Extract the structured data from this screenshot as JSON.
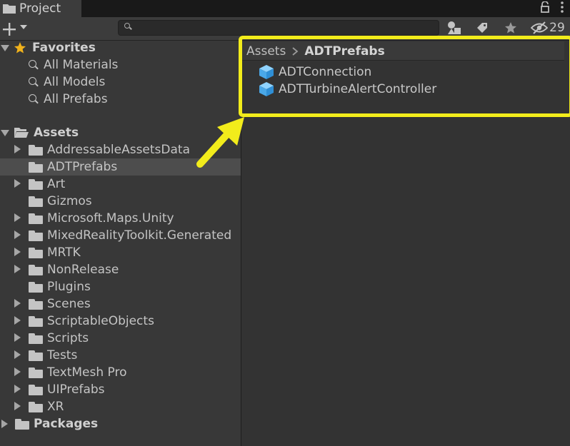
{
  "window": {
    "tab_title": "Project",
    "tab_icon": "folder-icon",
    "lock_icon": "lock-icon",
    "menu_icon": "kebab-menu-icon"
  },
  "toolbar": {
    "add_icon": "plus-icon",
    "search": {
      "value": "",
      "placeholder": ""
    },
    "filter_type_icon": "shapes-icon",
    "filter_label_icon": "tag-icon",
    "favorites_icon": "star-icon",
    "hidden_packages_icon": "eye-slash-icon",
    "hidden_count": "29"
  },
  "tree": {
    "favorites": {
      "label": "Favorites",
      "items": [
        "All Materials",
        "All Models",
        "All Prefabs"
      ]
    },
    "assets": {
      "label": "Assets",
      "folders": [
        {
          "label": "AddressableAssetsData",
          "expandable": true,
          "selected": false
        },
        {
          "label": "ADTPrefabs",
          "expandable": false,
          "selected": true
        },
        {
          "label": "Art",
          "expandable": true,
          "selected": false
        },
        {
          "label": "Gizmos",
          "expandable": false,
          "selected": false
        },
        {
          "label": "Microsoft.Maps.Unity",
          "expandable": true,
          "selected": false
        },
        {
          "label": "MixedRealityToolkit.Generated",
          "expandable": true,
          "selected": false
        },
        {
          "label": "MRTK",
          "expandable": true,
          "selected": false
        },
        {
          "label": "NonRelease",
          "expandable": true,
          "selected": false
        },
        {
          "label": "Plugins",
          "expandable": false,
          "selected": false
        },
        {
          "label": "Scenes",
          "expandable": true,
          "selected": false
        },
        {
          "label": "ScriptableObjects",
          "expandable": true,
          "selected": false
        },
        {
          "label": "Scripts",
          "expandable": true,
          "selected": false
        },
        {
          "label": "Tests",
          "expandable": true,
          "selected": false
        },
        {
          "label": "TextMesh Pro",
          "expandable": true,
          "selected": false
        },
        {
          "label": "UIPrefabs",
          "expandable": true,
          "selected": false
        },
        {
          "label": "XR",
          "expandable": true,
          "selected": false
        }
      ]
    },
    "packages": {
      "label": "Packages"
    }
  },
  "content": {
    "breadcrumb": {
      "root": "Assets",
      "separator": ">",
      "current": "ADTPrefabs"
    },
    "assets": [
      {
        "label": "ADTConnection",
        "icon": "prefab-cube-icon"
      },
      {
        "label": "ADTTurbineAlertController",
        "icon": "prefab-cube-icon"
      }
    ]
  },
  "annotation": {
    "highlight_color": "#f2ec1b"
  },
  "colors": {
    "panel": "#383838",
    "content": "#333333",
    "selected_row": "#4d4d4d",
    "prefab_icon": "#5cb8f0"
  }
}
